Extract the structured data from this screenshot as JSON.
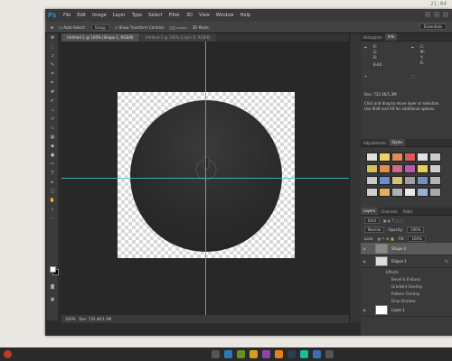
{
  "desktop": {
    "clock": "21:04"
  },
  "app": {
    "logo": "Ps",
    "menu": [
      "File",
      "Edit",
      "Image",
      "Layer",
      "Type",
      "Select",
      "Filter",
      "3D",
      "View",
      "Window",
      "Help"
    ]
  },
  "options": {
    "auto_select": "Auto-Select:",
    "auto_select_value": "Group",
    "show_transform": "Show Transform Controls",
    "mode_3d": "3D Mode:",
    "workspace": "Essentials"
  },
  "documents": {
    "tabs": [
      "Untitled-1 @ 100% (Shape 1, RGB/8)",
      "Untitled-2 @ 100% (Layer 0, RGB/8)"
    ]
  },
  "status": {
    "zoom": "100%",
    "doc": "Doc: 732.4K/1.3M"
  },
  "panels": {
    "info": {
      "tabs": [
        "Histogram",
        "Info"
      ],
      "r": "R:",
      "g": "G:",
      "b": "B:",
      "c": "C:",
      "m": "M:",
      "y": "Y:",
      "k": "K:",
      "bits": "8-bit",
      "doc": "Doc: 732.4K/1.3M",
      "hint1": "Click and drag to move layer or selection.",
      "hint2": "Use Shift and Alt for additional options."
    },
    "swatches": {
      "tabs": [
        "Adjustments",
        "Styles"
      ],
      "colors": [
        "#e0e0e0",
        "#f0d060",
        "#e48a5a",
        "#d95a5a",
        "#e0e0e0",
        "#cccccc",
        "#d6c15a",
        "#e08f4a",
        "#d06a88",
        "#b45ab0",
        "#e8d050",
        "#cccccc",
        "#c9c9c9",
        "#6a8fd8",
        "#d8c070",
        "#a0a0a0",
        "#7090c8",
        "#b4b4b4",
        "#d0d0d0",
        "#e0b060",
        "#b0b0b0",
        "#e8e8e8",
        "#9ab0d8",
        "#a8a8a8"
      ]
    },
    "layers": {
      "tabs": [
        "Layers",
        "Channels",
        "Paths"
      ],
      "kind": "Kind",
      "blend": "Normal",
      "opacity_label": "Opacity:",
      "opacity": "100%",
      "lock_label": "Lock:",
      "fill_label": "Fill:",
      "fill": "100%",
      "items": [
        "Shape 2",
        "Ellipse 1",
        "Layer 1"
      ],
      "effects_label": "Effects",
      "effects": [
        "Bevel & Emboss",
        "Gradient Overlay",
        "Pattern Overlay",
        "Drop Shadow"
      ]
    }
  }
}
